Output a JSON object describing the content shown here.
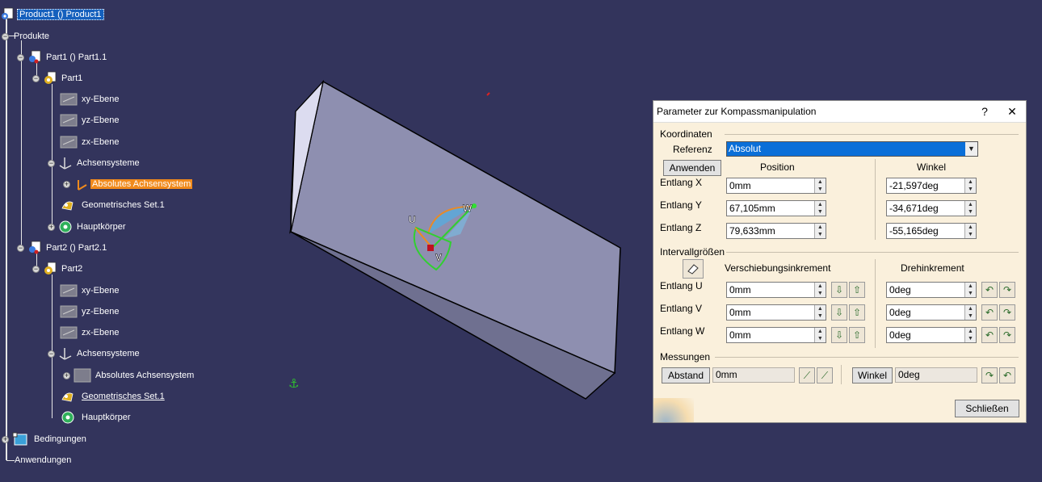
{
  "tree": {
    "root": "Product1 () Product1",
    "produkte": "Produkte",
    "part1_inst": "Part1 () Part1.1",
    "part1": "Part1",
    "p1_xy": "xy-Ebene",
    "p1_yz": "yz-Ebene",
    "p1_zx": "zx-Ebene",
    "p1_axes": "Achsensysteme",
    "p1_abs": "Absolutes Achsensystem",
    "p1_geo": "Geometrisches Set.1",
    "p1_body": "Hauptkörper",
    "part2_inst": "Part2 () Part2.1",
    "part2": "Part2",
    "p2_xy": "xy-Ebene",
    "p2_yz": "yz-Ebene",
    "p2_zx": "zx-Ebene",
    "p2_axes": "Achsensysteme",
    "p2_abs": "Absolutes Achsensystem",
    "p2_geo": "Geometrisches Set.1",
    "p2_body": "Hauptkörper",
    "constraints": "Bedingungen",
    "applications": "Anwendungen"
  },
  "compass": {
    "u": "U",
    "v": "V",
    "w": "W"
  },
  "dialog": {
    "title": "Parameter zur Kompassmanipulation",
    "help": "?",
    "close_x": "✕",
    "koordinaten": "Koordinaten",
    "referenz_label": "Referenz",
    "referenz_value": "Absolut",
    "anwenden": "Anwenden",
    "position_hdr": "Position",
    "winkel_hdr": "Winkel",
    "entlang_x": "Entlang X",
    "entlang_y": "Entlang Y",
    "entlang_z": "Entlang Z",
    "pos_x": "0mm",
    "pos_y": "67,105mm",
    "pos_z": "79,633mm",
    "ang_x": "-21,597deg",
    "ang_y": "-34,671deg",
    "ang_z": "-55,165deg",
    "intervall": "Intervallgrößen",
    "verschiebung_hdr": "Verschiebungsinkrement",
    "dreh_hdr": "Drehinkrement",
    "entlang_u": "Entlang U",
    "entlang_v": "Entlang V",
    "entlang_w": "Entlang W",
    "shift_u": "0mm",
    "shift_v": "0mm",
    "shift_w": "0mm",
    "rot_u": "0deg",
    "rot_v": "0deg",
    "rot_w": "0deg",
    "messungen": "Messungen",
    "abstand_btn": "Abstand",
    "abstand_val": "0mm",
    "winkel_btn": "Winkel",
    "winkel_val": "0deg",
    "schliessen": "Schließen"
  },
  "colors": {
    "background": "#33345c",
    "highlight": "#f08a1c",
    "selection": "#1560bd",
    "dialog_bg": "#faf0dc"
  }
}
